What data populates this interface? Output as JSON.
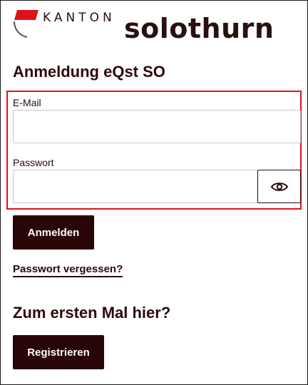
{
  "header": {
    "logo_kanton": "KANTON",
    "logo_name": "solothurn",
    "brand_color": "#e0101a"
  },
  "login": {
    "title": "Anmeldung eQst SO",
    "email_label": "E-Mail",
    "email_value": "",
    "password_label": "Passwort",
    "password_value": "",
    "toggle_icon": "eye-icon",
    "submit_label": "Anmelden",
    "forgot_link": "Passwort vergessen?"
  },
  "signup": {
    "title": "Zum ersten Mal hier?",
    "register_label": "Registrieren"
  },
  "colors": {
    "primary_button": "#2a0505",
    "highlight_border": "#e0101a"
  }
}
